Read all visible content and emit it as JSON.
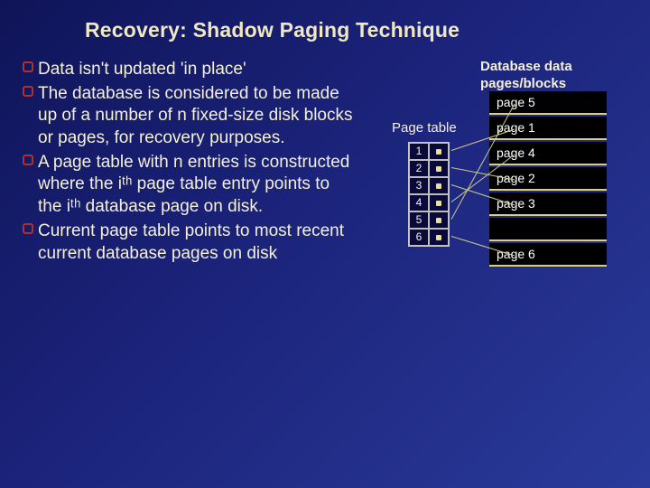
{
  "title": "Recovery: Shadow Paging Technique",
  "bullets": [
    "Data isn't updated 'in place'",
    "The database is considered to be made up of a number of n fixed-size disk blocks or pages, for recovery purposes.",
    "A page table with n entries is constructed where the iᵗʰ page table entry points to the iᵗʰ database page on disk.",
    "Current page table points to most recent current database pages on disk"
  ],
  "diagram": {
    "db_label": "Database data pages/blocks",
    "page_table_label": "Page table",
    "page_table_entries": [
      "1",
      "2",
      "3",
      "4",
      "5",
      "6"
    ],
    "blocks": [
      "page 5",
      "page 1",
      "page 4",
      "page 2",
      "page 3",
      "",
      "page 6"
    ]
  }
}
